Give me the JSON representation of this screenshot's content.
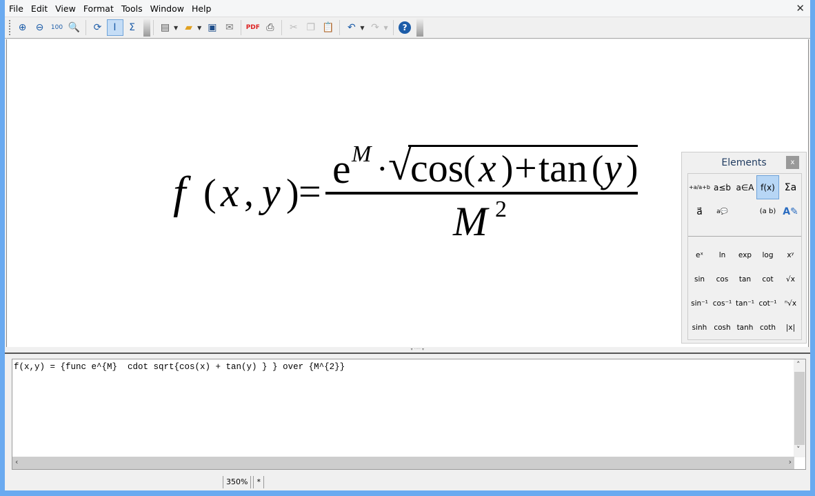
{
  "menu": [
    "File",
    "Edit",
    "View",
    "Format",
    "Tools",
    "Window",
    "Help"
  ],
  "toolbar": {
    "icons": [
      "zoom-in-icon",
      "zoom-out-icon",
      "zoom-100-icon",
      "show-all-icon",
      "update-icon",
      "formula-cursor-icon",
      "symbols-icon",
      "templates-icon",
      "open-icon",
      "save-icon",
      "mail-icon",
      "export-pdf-icon",
      "print-icon",
      "cut-icon",
      "copy-icon",
      "paste-icon",
      "undo-icon",
      "redo-icon",
      "help-icon"
    ]
  },
  "formula": {
    "lhs": "f",
    "args": [
      "(",
      "x",
      ",",
      "y",
      ")",
      "="
    ],
    "num_base": "e",
    "num_exp": "M",
    "cdot": "·",
    "root": "√",
    "cos": "cos",
    "x": "x",
    "plus": "+",
    "tan": "tan",
    "y": "y",
    "den": "M",
    "den_exp": "2"
  },
  "elements": {
    "title": "Elements",
    "close": "x",
    "categories": [
      "+a/a+b",
      "a≤b",
      "a∈A",
      "f(x)",
      "Σa",
      "a⃗",
      "a💬",
      "(a b)",
      "A✎"
    ],
    "functions": [
      "eˣ",
      "ln",
      "exp",
      "log",
      "xʸ",
      "sin",
      "cos",
      "tan",
      "cot",
      "√x",
      "sin⁻¹",
      "cos⁻¹",
      "tan⁻¹",
      "cot⁻¹",
      "ⁿ√x",
      "sinh",
      "cosh",
      "tanh",
      "coth",
      "|x|"
    ]
  },
  "command": "f(x,y) = {func e^{M}  cdot sqrt{cos(x) + tan(y) } } over {M^{2}}",
  "status": {
    "zoom": "350%",
    "modified": "*"
  }
}
